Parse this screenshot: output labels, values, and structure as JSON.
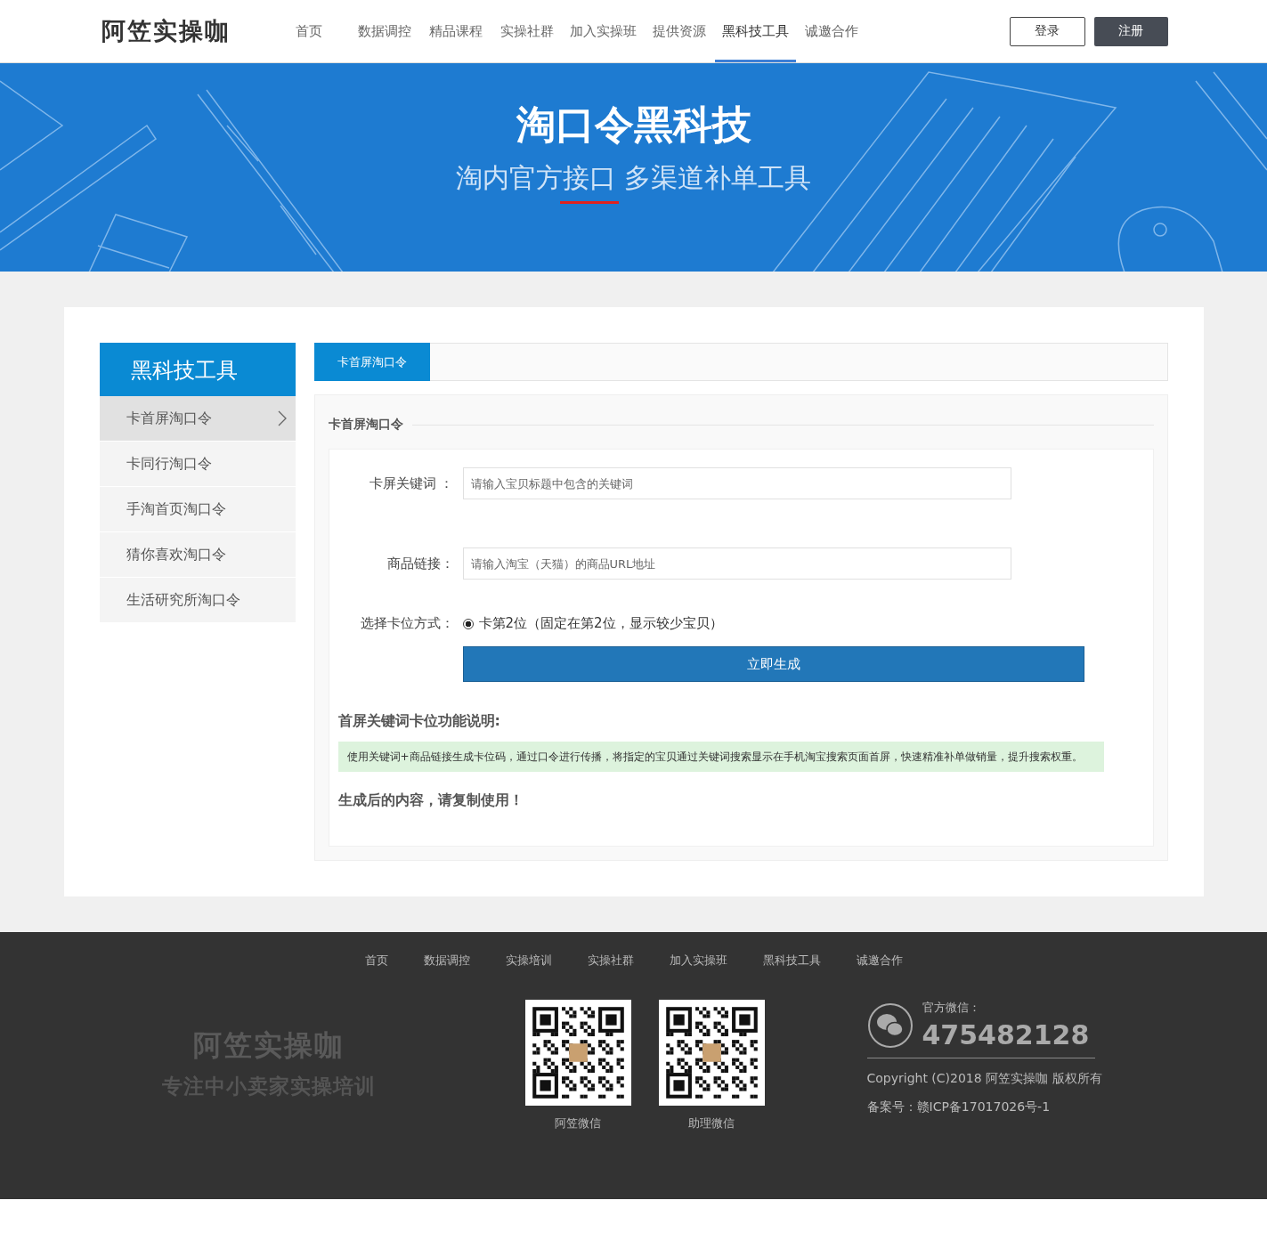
{
  "header": {
    "logo": "阿笠实操咖",
    "nav": [
      {
        "label": "首页",
        "selected": false
      },
      {
        "label": "数据调控",
        "selected": false
      },
      {
        "label": "精品课程",
        "selected": false
      },
      {
        "label": "实操社群",
        "selected": false
      },
      {
        "label": "加入实操班",
        "selected": false
      },
      {
        "label": "提供资源",
        "selected": false
      },
      {
        "label": "黑科技工具",
        "selected": true
      },
      {
        "label": "诚邀合作",
        "selected": false
      }
    ],
    "login": "登录",
    "register": "注册"
  },
  "banner": {
    "title": "淘口令黑科技",
    "subtitle": "淘内官方接口 多渠道补单工具"
  },
  "sidebar": {
    "title": "黑科技工具",
    "items": [
      {
        "label": "卡首屏淘口令",
        "selected": true
      },
      {
        "label": "卡同行淘口令",
        "selected": false
      },
      {
        "label": "手淘首页淘口令",
        "selected": false
      },
      {
        "label": "猜你喜欢淘口令",
        "selected": false
      },
      {
        "label": "生活研究所淘口令",
        "selected": false
      }
    ]
  },
  "tabs": [
    {
      "label": "卡首屏淘口令",
      "selected": true
    }
  ],
  "form": {
    "legend": "卡首屏淘口令",
    "fields": [
      {
        "kind": "text",
        "label": "卡屏关键词 ：",
        "placeholder": "请输入宝贝标题中包含的关键词"
      },
      {
        "kind": "text",
        "label": "商品链接：",
        "placeholder": "请输入淘宝（天猫）的商品URL地址"
      },
      {
        "kind": "radio",
        "label": "选择卡位方式：",
        "option": "卡第2位（固定在第2位，显示较少宝贝）",
        "checked": true
      }
    ],
    "submit": "立即生成"
  },
  "info": {
    "heading": "首屏关键词卡位功能说明:",
    "description": "使用关键词+商品链接生成卡位码，通过口令进行传播，将指定的宝贝通过关键词搜索显示在手机淘宝搜索页面首屏，快速精准补单做销量，提升搜索权重。",
    "result_heading": "生成后的内容，请复制使用！"
  },
  "footer": {
    "nav": [
      "首页",
      "数据调控",
      "实操培训",
      "实操社群",
      "加入实操班",
      "黑科技工具",
      "诚邀合作"
    ],
    "logo": "阿笠实操咖",
    "slogan": "专注中小卖家实操培训",
    "qr_codes": [
      {
        "caption": "阿笠微信"
      },
      {
        "caption": "助理微信"
      }
    ],
    "wechat_label": "官方微信：",
    "wechat_number": "475482128",
    "copyright": "Copyright (C)2018 阿笠实操咖 版权所有",
    "icp": "备案号：赣ICP备17017026号-1"
  }
}
